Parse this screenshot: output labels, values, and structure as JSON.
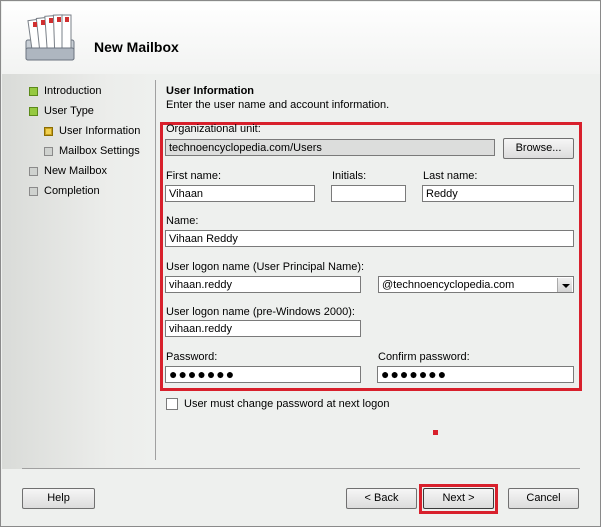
{
  "header": {
    "title": "New Mailbox"
  },
  "nav": {
    "items": [
      {
        "label": "Introduction",
        "status": "done"
      },
      {
        "label": "User Type",
        "status": "done"
      },
      {
        "label": "User Information",
        "status": "current"
      },
      {
        "label": "Mailbox Settings",
        "status": "pending"
      },
      {
        "label": "New Mailbox",
        "status": "pending"
      },
      {
        "label": "Completion",
        "status": "pending"
      }
    ]
  },
  "section": {
    "title": "User Information",
    "description": "Enter the user name and account information."
  },
  "form": {
    "ou_label": "Organizational unit:",
    "ou_value": "technoencyclopedia.com/Users",
    "browse_label": "Browse...",
    "first_name_label": "First name:",
    "first_name_value": "Vihaan",
    "initials_label": "Initials:",
    "initials_value": "",
    "last_name_label": "Last name:",
    "last_name_value": "Reddy",
    "name_label": "Name:",
    "name_value": "Vihaan Reddy",
    "upn_label": "User logon name (User Principal Name):",
    "upn_value": "vihaan.reddy",
    "upn_domain_value": "@technoencyclopedia.com",
    "prewin_label": "User logon name (pre-Windows 2000):",
    "prewin_value": "vihaan.reddy",
    "password_label": "Password:",
    "password_value": "●●●●●●●",
    "confirm_label": "Confirm password:",
    "confirm_value": "●●●●●●●",
    "must_change_label": "User must change password at next logon",
    "must_change_checked": false
  },
  "footer": {
    "help_label": "Help",
    "back_label": "< Back",
    "next_label": "Next >",
    "cancel_label": "Cancel"
  },
  "colors": {
    "highlight": "#d8202c",
    "done": "#95c940",
    "current": "#f0d050"
  }
}
